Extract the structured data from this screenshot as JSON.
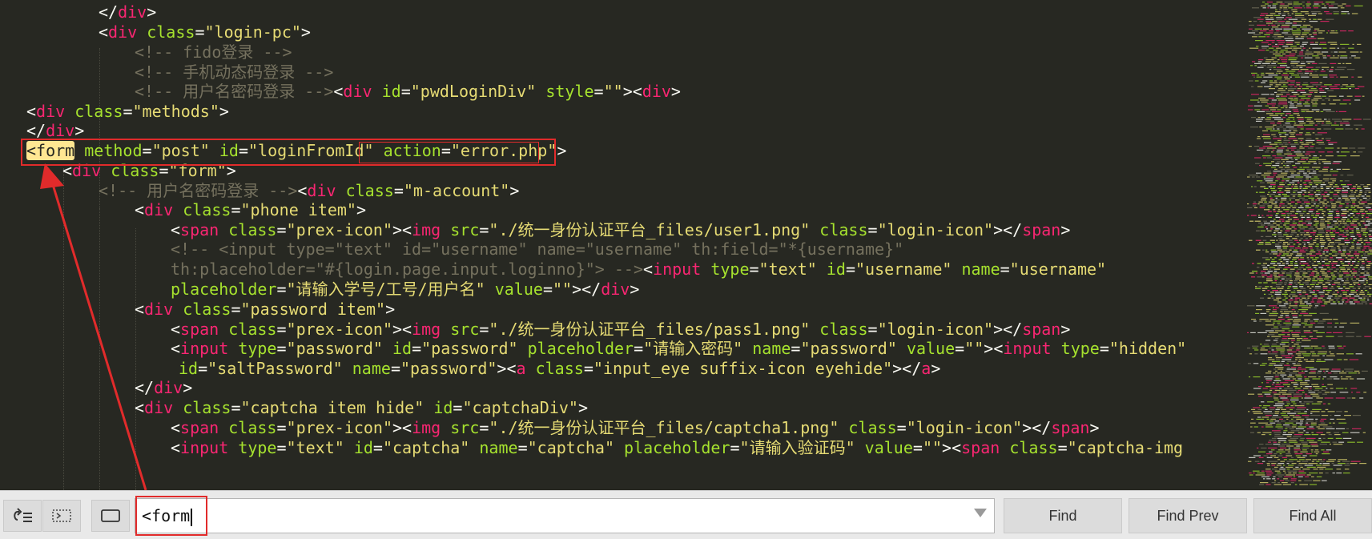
{
  "code_lines": [
    {
      "segments": [
        {
          "t": "p",
          "v": "</"
        },
        {
          "t": "t",
          "v": "div"
        },
        {
          "t": "p",
          "v": ">"
        }
      ]
    },
    {
      "segments": [
        {
          "t": "p",
          "v": "<"
        },
        {
          "t": "t",
          "v": "div"
        },
        {
          "t": "p",
          "v": " "
        },
        {
          "t": "a",
          "v": "class"
        },
        {
          "t": "p",
          "v": "="
        },
        {
          "t": "s",
          "v": "\"login-pc\""
        },
        {
          "t": "p",
          "v": ">"
        }
      ]
    },
    {
      "segments": [
        {
          "t": "c",
          "v": "<!-- fido登录 -->"
        }
      ]
    },
    {
      "segments": [
        {
          "t": "c",
          "v": "<!-- 手机动态码登录 -->"
        }
      ]
    },
    {
      "segments": [
        {
          "t": "c",
          "v": "<!-- 用户名密码登录 -->"
        },
        {
          "t": "p",
          "v": "<"
        },
        {
          "t": "t",
          "v": "div"
        },
        {
          "t": "p",
          "v": " "
        },
        {
          "t": "a",
          "v": "id"
        },
        {
          "t": "p",
          "v": "="
        },
        {
          "t": "s",
          "v": "\"pwdLoginDiv\""
        },
        {
          "t": "p",
          "v": " "
        },
        {
          "t": "a",
          "v": "style"
        },
        {
          "t": "p",
          "v": "="
        },
        {
          "t": "s",
          "v": "\"\""
        },
        {
          "t": "p",
          "v": "><"
        },
        {
          "t": "t",
          "v": "div"
        },
        {
          "t": "p",
          "v": ">"
        }
      ]
    },
    {
      "segments": [
        {
          "t": "p",
          "v": "<"
        },
        {
          "t": "t",
          "v": "div"
        },
        {
          "t": "p",
          "v": " "
        },
        {
          "t": "a",
          "v": "class"
        },
        {
          "t": "p",
          "v": "="
        },
        {
          "t": "s",
          "v": "\"methods\""
        },
        {
          "t": "p",
          "v": ">"
        }
      ]
    },
    {
      "segments": [
        {
          "t": "p",
          "v": "</"
        },
        {
          "t": "t",
          "v": "div"
        },
        {
          "t": "p",
          "v": ">"
        }
      ]
    },
    {
      "segments": [
        {
          "t": "hl",
          "v": "<form"
        },
        {
          "t": "p",
          "v": " "
        },
        {
          "t": "a",
          "v": "method"
        },
        {
          "t": "p",
          "v": "="
        },
        {
          "t": "s",
          "v": "\"post\""
        },
        {
          "t": "p",
          "v": " "
        },
        {
          "t": "a",
          "v": "id"
        },
        {
          "t": "p",
          "v": "="
        },
        {
          "t": "s",
          "v": "\"loginFromId\""
        },
        {
          "t": "p",
          "v": " "
        },
        {
          "t": "a",
          "v": "action"
        },
        {
          "t": "p",
          "v": "="
        },
        {
          "t": "s",
          "v": "\"error.php\""
        },
        {
          "t": "p",
          "v": ">"
        }
      ]
    },
    {
      "segments": [
        {
          "t": "p",
          "v": "<"
        },
        {
          "t": "t",
          "v": "div"
        },
        {
          "t": "p",
          "v": " "
        },
        {
          "t": "a",
          "v": "class"
        },
        {
          "t": "p",
          "v": "="
        },
        {
          "t": "s",
          "v": "\"form\""
        },
        {
          "t": "p",
          "v": ">"
        }
      ]
    },
    {
      "segments": [
        {
          "t": "c",
          "v": "<!-- 用户名密码登录 -->"
        },
        {
          "t": "p",
          "v": "<"
        },
        {
          "t": "t",
          "v": "div"
        },
        {
          "t": "p",
          "v": " "
        },
        {
          "t": "a",
          "v": "class"
        },
        {
          "t": "p",
          "v": "="
        },
        {
          "t": "s",
          "v": "\"m-account\""
        },
        {
          "t": "p",
          "v": ">"
        }
      ]
    },
    {
      "segments": [
        {
          "t": "p",
          "v": "<"
        },
        {
          "t": "t",
          "v": "div"
        },
        {
          "t": "p",
          "v": " "
        },
        {
          "t": "a",
          "v": "class"
        },
        {
          "t": "p",
          "v": "="
        },
        {
          "t": "s",
          "v": "\"phone item\""
        },
        {
          "t": "p",
          "v": ">"
        }
      ]
    },
    {
      "segments": [
        {
          "t": "p",
          "v": "<"
        },
        {
          "t": "t",
          "v": "span"
        },
        {
          "t": "p",
          "v": " "
        },
        {
          "t": "a",
          "v": "class"
        },
        {
          "t": "p",
          "v": "="
        },
        {
          "t": "s",
          "v": "\"prex-icon\""
        },
        {
          "t": "p",
          "v": "><"
        },
        {
          "t": "t",
          "v": "img"
        },
        {
          "t": "p",
          "v": " "
        },
        {
          "t": "a",
          "v": "src"
        },
        {
          "t": "p",
          "v": "="
        },
        {
          "t": "s",
          "v": "\"./统一身份认证平台_files/user1.png\""
        },
        {
          "t": "p",
          "v": " "
        },
        {
          "t": "a",
          "v": "class"
        },
        {
          "t": "p",
          "v": "="
        },
        {
          "t": "s",
          "v": "\"login-icon\""
        },
        {
          "t": "p",
          "v": "></"
        },
        {
          "t": "t",
          "v": "span"
        },
        {
          "t": "p",
          "v": ">"
        }
      ]
    },
    {
      "segments": [
        {
          "t": "c",
          "v": "<!-- <input type=\"text\" id=\"username\" name=\"username\" th:field=\"*{username}\""
        }
      ]
    },
    {
      "segments": [
        {
          "t": "c",
          "v": "th:placeholder=\"#{login.page.input.loginno}\"> -->"
        },
        {
          "t": "p",
          "v": "<"
        },
        {
          "t": "t",
          "v": "input"
        },
        {
          "t": "p",
          "v": " "
        },
        {
          "t": "a",
          "v": "type"
        },
        {
          "t": "p",
          "v": "="
        },
        {
          "t": "s",
          "v": "\"text\""
        },
        {
          "t": "p",
          "v": " "
        },
        {
          "t": "a",
          "v": "id"
        },
        {
          "t": "p",
          "v": "="
        },
        {
          "t": "s",
          "v": "\"username\""
        },
        {
          "t": "p",
          "v": " "
        },
        {
          "t": "a",
          "v": "name"
        },
        {
          "t": "p",
          "v": "="
        },
        {
          "t": "s",
          "v": "\"username\""
        }
      ]
    },
    {
      "segments": [
        {
          "t": "a",
          "v": "placeholder"
        },
        {
          "t": "p",
          "v": "="
        },
        {
          "t": "s",
          "v": "\"请输入学号/工号/用户名\""
        },
        {
          "t": "p",
          "v": " "
        },
        {
          "t": "a",
          "v": "value"
        },
        {
          "t": "p",
          "v": "="
        },
        {
          "t": "s",
          "v": "\"\""
        },
        {
          "t": "p",
          "v": "></"
        },
        {
          "t": "t",
          "v": "div"
        },
        {
          "t": "p",
          "v": ">"
        }
      ]
    },
    {
      "segments": [
        {
          "t": "p",
          "v": "<"
        },
        {
          "t": "t",
          "v": "div"
        },
        {
          "t": "p",
          "v": " "
        },
        {
          "t": "a",
          "v": "class"
        },
        {
          "t": "p",
          "v": "="
        },
        {
          "t": "s",
          "v": "\"password item\""
        },
        {
          "t": "p",
          "v": ">"
        }
      ]
    },
    {
      "segments": [
        {
          "t": "p",
          "v": "<"
        },
        {
          "t": "t",
          "v": "span"
        },
        {
          "t": "p",
          "v": " "
        },
        {
          "t": "a",
          "v": "class"
        },
        {
          "t": "p",
          "v": "="
        },
        {
          "t": "s",
          "v": "\"prex-icon\""
        },
        {
          "t": "p",
          "v": "><"
        },
        {
          "t": "t",
          "v": "img"
        },
        {
          "t": "p",
          "v": " "
        },
        {
          "t": "a",
          "v": "src"
        },
        {
          "t": "p",
          "v": "="
        },
        {
          "t": "s",
          "v": "\"./统一身份认证平台_files/pass1.png\""
        },
        {
          "t": "p",
          "v": " "
        },
        {
          "t": "a",
          "v": "class"
        },
        {
          "t": "p",
          "v": "="
        },
        {
          "t": "s",
          "v": "\"login-icon\""
        },
        {
          "t": "p",
          "v": "></"
        },
        {
          "t": "t",
          "v": "span"
        },
        {
          "t": "p",
          "v": ">"
        }
      ]
    },
    {
      "segments": [
        {
          "t": "p",
          "v": "<"
        },
        {
          "t": "t",
          "v": "input"
        },
        {
          "t": "p",
          "v": " "
        },
        {
          "t": "a",
          "v": "type"
        },
        {
          "t": "p",
          "v": "="
        },
        {
          "t": "s",
          "v": "\"password\""
        },
        {
          "t": "p",
          "v": " "
        },
        {
          "t": "a",
          "v": "id"
        },
        {
          "t": "p",
          "v": "="
        },
        {
          "t": "s",
          "v": "\"password\""
        },
        {
          "t": "p",
          "v": " "
        },
        {
          "t": "a",
          "v": "placeholder"
        },
        {
          "t": "p",
          "v": "="
        },
        {
          "t": "s",
          "v": "\"请输入密码\""
        },
        {
          "t": "p",
          "v": " "
        },
        {
          "t": "a",
          "v": "name"
        },
        {
          "t": "p",
          "v": "="
        },
        {
          "t": "s",
          "v": "\"password\""
        },
        {
          "t": "p",
          "v": " "
        },
        {
          "t": "a",
          "v": "value"
        },
        {
          "t": "p",
          "v": "="
        },
        {
          "t": "s",
          "v": "\"\""
        },
        {
          "t": "p",
          "v": "><"
        },
        {
          "t": "t",
          "v": "input"
        },
        {
          "t": "p",
          "v": " "
        },
        {
          "t": "a",
          "v": "type"
        },
        {
          "t": "p",
          "v": "="
        },
        {
          "t": "s",
          "v": "\"hidden\""
        }
      ]
    },
    {
      "segments": [
        {
          "t": "a",
          "v": "id"
        },
        {
          "t": "p",
          "v": "="
        },
        {
          "t": "s",
          "v": "\"saltPassword\""
        },
        {
          "t": "p",
          "v": " "
        },
        {
          "t": "a",
          "v": "name"
        },
        {
          "t": "p",
          "v": "="
        },
        {
          "t": "s",
          "v": "\"password\""
        },
        {
          "t": "p",
          "v": "><"
        },
        {
          "t": "t",
          "v": "a"
        },
        {
          "t": "p",
          "v": " "
        },
        {
          "t": "a",
          "v": "class"
        },
        {
          "t": "p",
          "v": "="
        },
        {
          "t": "s",
          "v": "\"input_eye suffix-icon eyehide\""
        },
        {
          "t": "p",
          "v": "></"
        },
        {
          "t": "t",
          "v": "a"
        },
        {
          "t": "p",
          "v": ">"
        }
      ]
    },
    {
      "segments": [
        {
          "t": "p",
          "v": "</"
        },
        {
          "t": "t",
          "v": "div"
        },
        {
          "t": "p",
          "v": ">"
        }
      ]
    },
    {
      "segments": [
        {
          "t": "p",
          "v": "<"
        },
        {
          "t": "t",
          "v": "div"
        },
        {
          "t": "p",
          "v": " "
        },
        {
          "t": "a",
          "v": "class"
        },
        {
          "t": "p",
          "v": "="
        },
        {
          "t": "s",
          "v": "\"captcha item hide\""
        },
        {
          "t": "p",
          "v": " "
        },
        {
          "t": "a",
          "v": "id"
        },
        {
          "t": "p",
          "v": "="
        },
        {
          "t": "s",
          "v": "\"captchaDiv\""
        },
        {
          "t": "p",
          "v": ">"
        }
      ]
    },
    {
      "segments": [
        {
          "t": "p",
          "v": "<"
        },
        {
          "t": "t",
          "v": "span"
        },
        {
          "t": "p",
          "v": " "
        },
        {
          "t": "a",
          "v": "class"
        },
        {
          "t": "p",
          "v": "="
        },
        {
          "t": "s",
          "v": "\"prex-icon\""
        },
        {
          "t": "p",
          "v": "><"
        },
        {
          "t": "t",
          "v": "img"
        },
        {
          "t": "p",
          "v": " "
        },
        {
          "t": "a",
          "v": "src"
        },
        {
          "t": "p",
          "v": "="
        },
        {
          "t": "s",
          "v": "\"./统一身份认证平台_files/captcha1.png\""
        },
        {
          "t": "p",
          "v": " "
        },
        {
          "t": "a",
          "v": "class"
        },
        {
          "t": "p",
          "v": "="
        },
        {
          "t": "s",
          "v": "\"login-icon\""
        },
        {
          "t": "p",
          "v": "></"
        },
        {
          "t": "t",
          "v": "span"
        },
        {
          "t": "p",
          "v": ">"
        }
      ]
    },
    {
      "segments": [
        {
          "t": "p",
          "v": "<"
        },
        {
          "t": "t",
          "v": "input"
        },
        {
          "t": "p",
          "v": " "
        },
        {
          "t": "a",
          "v": "type"
        },
        {
          "t": "p",
          "v": "="
        },
        {
          "t": "s",
          "v": "\"text\""
        },
        {
          "t": "p",
          "v": " "
        },
        {
          "t": "a",
          "v": "id"
        },
        {
          "t": "p",
          "v": "="
        },
        {
          "t": "s",
          "v": "\"captcha\""
        },
        {
          "t": "p",
          "v": " "
        },
        {
          "t": "a",
          "v": "name"
        },
        {
          "t": "p",
          "v": "="
        },
        {
          "t": "s",
          "v": "\"captcha\""
        },
        {
          "t": "p",
          "v": " "
        },
        {
          "t": "a",
          "v": "placeholder"
        },
        {
          "t": "p",
          "v": "="
        },
        {
          "t": "s",
          "v": "\"请输入验证码\""
        },
        {
          "t": "p",
          "v": " "
        },
        {
          "t": "a",
          "v": "value"
        },
        {
          "t": "p",
          "v": "="
        },
        {
          "t": "s",
          "v": "\"\""
        },
        {
          "t": "p",
          "v": "><"
        },
        {
          "t": "t",
          "v": "span"
        },
        {
          "t": "p",
          "v": " "
        },
        {
          "t": "a",
          "v": "class"
        },
        {
          "t": "p",
          "v": "="
        },
        {
          "t": "s",
          "v": "\"captcha-img"
        }
      ]
    }
  ],
  "syntax_colors": {
    "tag": "#f92672",
    "attribute": "#a6e22e",
    "string": "#e6db74",
    "comment": "#75715e",
    "plain": "#f8f8f2",
    "match_highlight": "#ffe792",
    "annotation": "#e12b2b"
  },
  "find_bar": {
    "options": [
      {
        "icon": "wrap-around-icon"
      },
      {
        "icon": "in-selection-icon"
      },
      {
        "icon": "highlight-matches-icon"
      }
    ],
    "search_value": "<form",
    "buttons": {
      "find": "Find",
      "find_prev": "Find Prev",
      "find_all": "Find All"
    }
  }
}
